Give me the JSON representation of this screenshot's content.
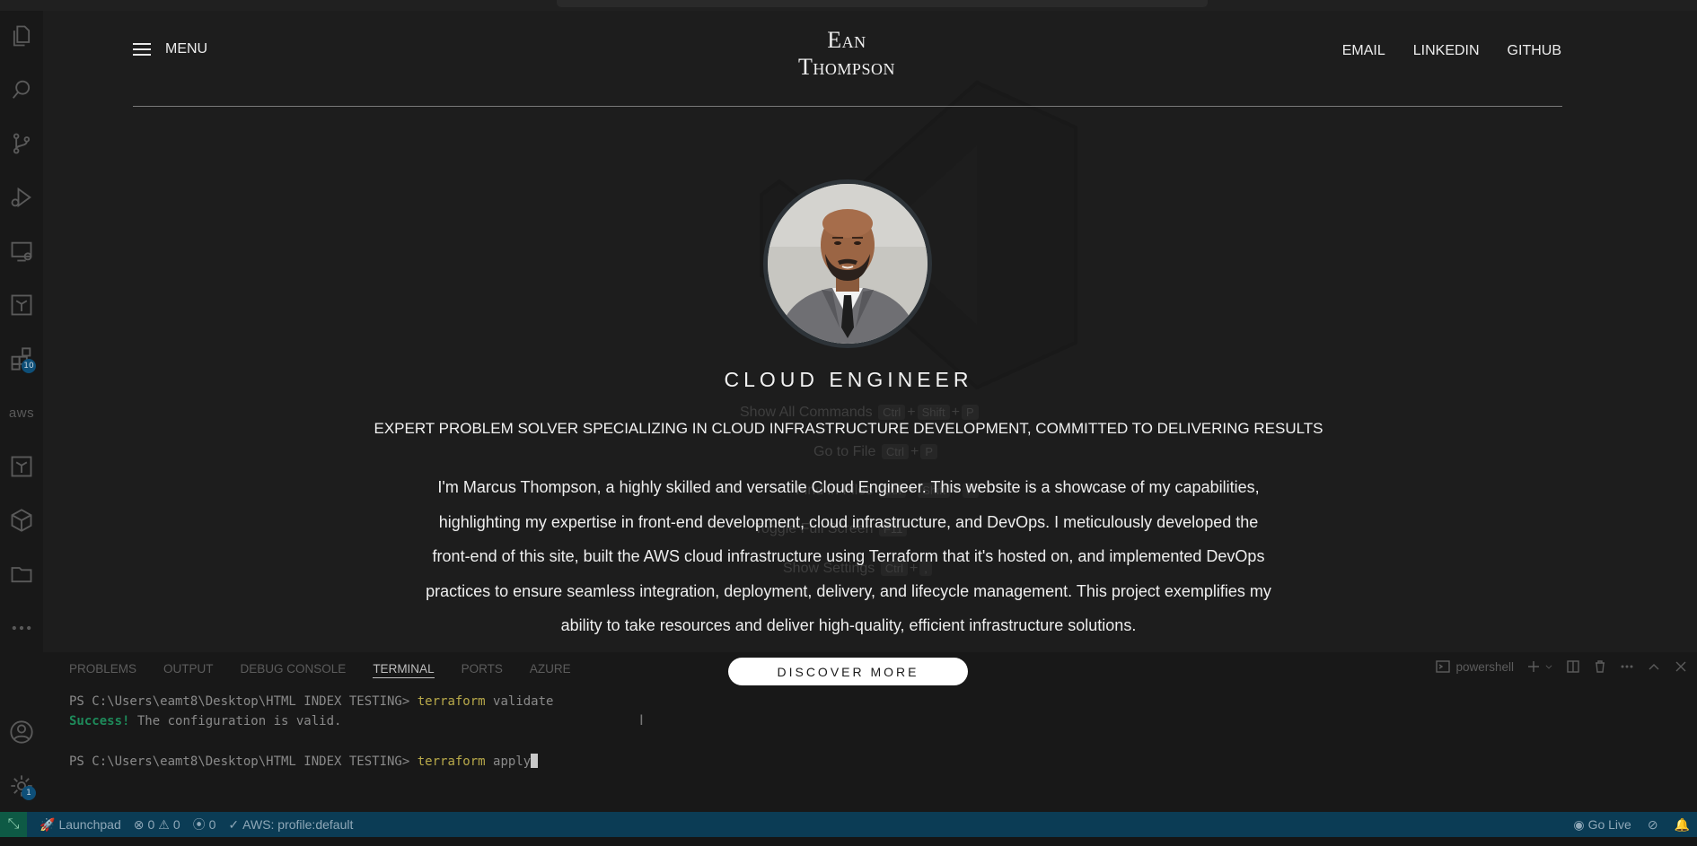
{
  "site": {
    "menu_label": "MENU",
    "logo_line1": "Ean",
    "logo_line2": "Thompson",
    "nav_links": [
      "EMAIL",
      "LINKEDIN",
      "GITHUB"
    ],
    "role": "CLOUD ENGINEER",
    "tagline": "EXPERT PROBLEM SOLVER SPECIALIZING IN CLOUD INFRASTRUCTURE DEVELOPMENT, COMMITTED TO DELIVERING RESULTS",
    "bio": "I'm Marcus Thompson, a highly skilled and versatile Cloud Engineer. This website is a showcase of my capabilities, highlighting my expertise in front-end development, cloud infrastructure, and DevOps. I meticulously developed the front-end of this site, built the AWS cloud infrastructure using Terraform that it's hosted on, and implemented DevOps practices to ensure seamless integration, deployment, delivery, and lifecycle management. This project exemplifies my ability to take resources and deliver high-quality, efficient infrastructure solutions.",
    "discover_label": "DISCOVER MORE"
  },
  "editor_hints": [
    {
      "label": "Show All Commands",
      "keys": [
        "Ctrl",
        "+",
        "Shift",
        "+",
        "P"
      ]
    },
    {
      "label": "Go to File",
      "keys": [
        "Ctrl",
        "+",
        "P"
      ]
    },
    {
      "label": "Find in Files",
      "keys": [
        "Ctrl",
        "+",
        "Shift",
        "+",
        "F"
      ]
    },
    {
      "label": "Toggle Full Screen",
      "keys": [
        "F11"
      ]
    },
    {
      "label": "Show Settings",
      "keys": [
        "Ctrl",
        "+",
        ","
      ]
    }
  ],
  "activity_bar": {
    "icons": [
      "explorer-icon",
      "search-icon",
      "source-control-icon",
      "run-debug-icon",
      "remote-explorer-icon",
      "terraform-icon",
      "extensions-icon",
      "aws-icon",
      "terraform-cloud-icon",
      "package-icon",
      "folder-icon",
      "more-icon",
      "account-icon",
      "settings-icon"
    ],
    "extensions_badge": "10",
    "settings_badge": "1",
    "aws_label": "aws"
  },
  "panel": {
    "tabs": [
      "PROBLEMS",
      "OUTPUT",
      "DEBUG CONSOLE",
      "TERMINAL",
      "PORTS",
      "AZURE"
    ],
    "active_tab": "TERMINAL",
    "shell_label": "powershell",
    "terminal": {
      "prompt": "PS C:\\Users\\eamt8\\Desktop\\HTML INDEX TESTING>",
      "cmd1_bin": "terraform",
      "cmd1_arg": "validate",
      "success_word": "Success!",
      "success_rest": " The configuration is valid.",
      "cmd2_bin": "terraform",
      "cmd2_arg": "apply"
    }
  },
  "status_bar": {
    "launchpad": "Launchpad",
    "errors": "0",
    "warnings": "0",
    "ports": "0",
    "aws_profile": "AWS: profile:default",
    "go_live": "Go Live"
  },
  "colors": {
    "status_bar": "#0b3c55",
    "remote_button": "#0e5a45",
    "terminal_command": "#b8a94a",
    "terminal_success": "#1e8a5a"
  }
}
